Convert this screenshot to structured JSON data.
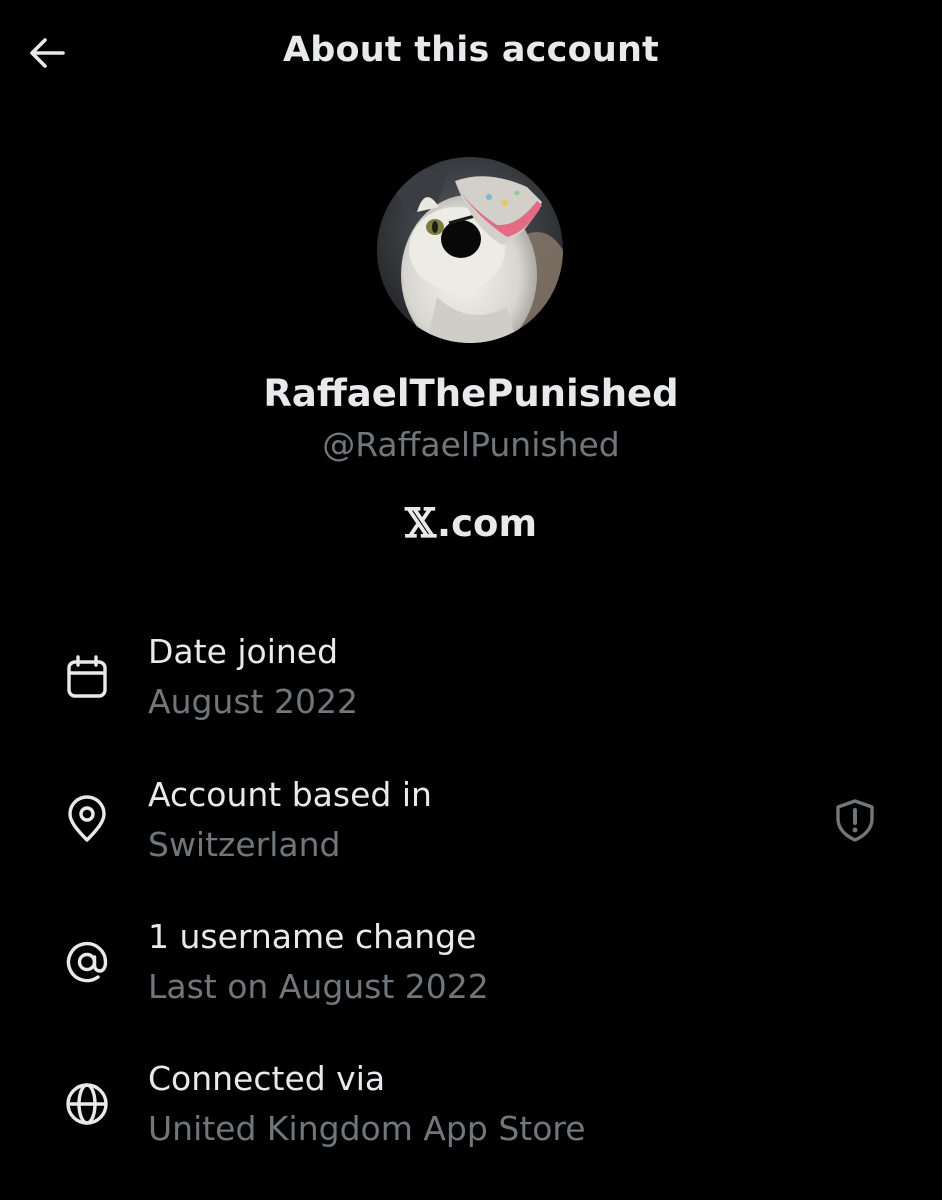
{
  "header": {
    "title": "About this account",
    "back_icon": "back-arrow-icon"
  },
  "profile": {
    "display_name": "RaffaelThePunished",
    "handle": "@RaffaelPunished",
    "avatar": "avatar-photo-cat-with-party-hat",
    "platform_logo": "𝕏",
    "platform_suffix": ".com"
  },
  "rows": [
    {
      "icon": "calendar-icon",
      "label": "Date joined",
      "value": "August 2022"
    },
    {
      "icon": "location-pin-icon",
      "label": "Account based in",
      "value": "Switzerland",
      "trailing_icon": "shield-alert-icon"
    },
    {
      "icon": "at-sign-icon",
      "label": "1 username change",
      "value": "Last on August 2022"
    },
    {
      "icon": "globe-icon",
      "label": "Connected via",
      "value": "United Kingdom App Store"
    }
  ],
  "colors": {
    "background": "#000000",
    "primary_text": "#e7e9ea",
    "secondary_text": "#71767b"
  }
}
